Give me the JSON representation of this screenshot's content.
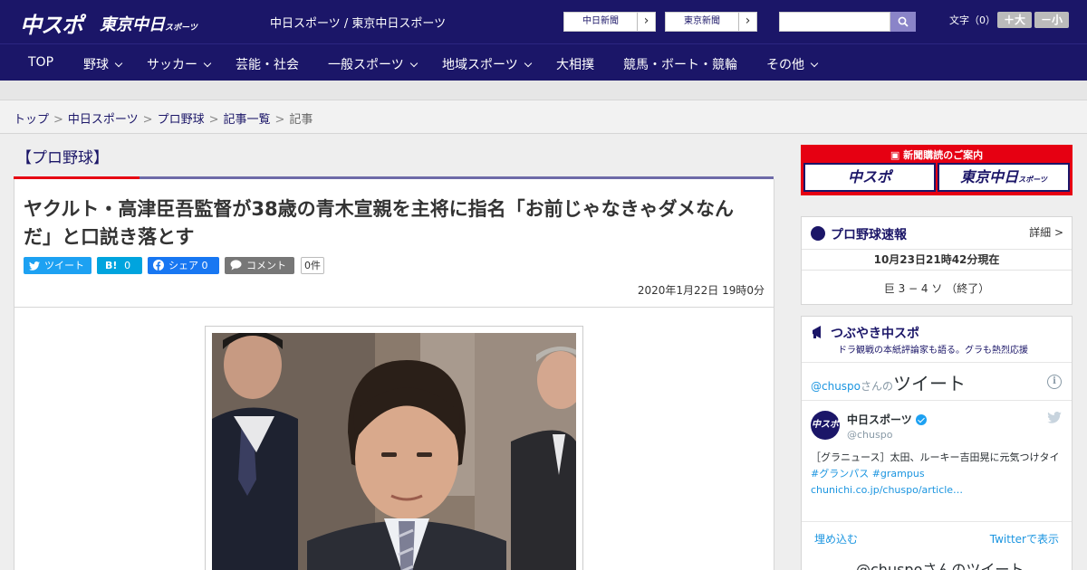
{
  "header": {
    "logo_chuspo": "中スポ",
    "logo_tokyo": "東京中日",
    "logo_tokyo_sub": "スポーツ",
    "site_title": "中日スポーツ / 東京中日スポーツ",
    "paper_links": [
      {
        "label": "中日新聞"
      },
      {
        "label": "東京新聞"
      }
    ],
    "search": {
      "placeholder": ""
    },
    "font_size_label": "文字（0）",
    "font_larger": "＋大",
    "font_smaller": "－小"
  },
  "nav": {
    "items": [
      {
        "label": "TOP",
        "has_menu": false
      },
      {
        "label": "野球",
        "has_menu": true
      },
      {
        "label": "サッカー",
        "has_menu": true
      },
      {
        "label": "芸能・社会",
        "has_menu": false
      },
      {
        "label": "一般スポーツ",
        "has_menu": true
      },
      {
        "label": "地域スポーツ",
        "has_menu": true
      },
      {
        "label": "大相撲",
        "has_menu": false
      },
      {
        "label": "競馬・ボート・競輪",
        "has_menu": false
      },
      {
        "label": "その他",
        "has_menu": true
      }
    ]
  },
  "breadcrumb": {
    "items": [
      "トップ",
      "中日スポーツ",
      "プロ野球",
      "記事一覧"
    ],
    "current": "記事",
    "separator": ">"
  },
  "article": {
    "category": "【プロ野球】",
    "headline": "ヤクルト・高津臣吾監督が38歳の青木宣親を主将に指名「お前じゃなきゃダメなんだ」と口説き落とす",
    "share": {
      "tweet": "ツイート",
      "hatena_label": "B!",
      "hatena_count": "0",
      "facebook": "シェア",
      "facebook_count": "0",
      "comment": "コメント",
      "comment_count": "0件"
    },
    "date": "2020年1月22日 19時0分"
  },
  "sidebar": {
    "subscribe": {
      "title": "新聞購読のご案内",
      "chuspo": "中スポ",
      "tokyo": "東京中日",
      "tokyo_sub": "スポーツ"
    },
    "scores": {
      "title": "プロ野球速報",
      "detail": "詳細 >",
      "time": "10月23日21時42分現在",
      "game": "巨 3 − 4 ソ （終了）"
    },
    "twitter": {
      "title": "つぶやき中スポ",
      "subtitle": "ドラ観戦の本紙評論家も語る。グラも熱烈応援",
      "head_handle": "@chuspo",
      "head_san": "さんの",
      "head_tweet": "ツイート",
      "account_name": "中日スポーツ",
      "account_handle": "@chuspo",
      "avatar_text": "中スポ",
      "tweet_text": "［グラニュース］太田、ルーキー吉田晃に元気つけタイ",
      "tweet_tags": "#グランパス #grampus",
      "tweet_link": "chunichi.co.jp/chuspo/article…",
      "embed": "埋め込む",
      "view_on_twitter": "Twitterで表示",
      "footer": "@chuspoさんのツイート"
    }
  },
  "colors": {
    "brand_navy": "#1b1668",
    "accent_red": "#e60012",
    "twitter_blue": "#1da1f2",
    "hatena_blue": "#00a4de",
    "facebook_blue": "#1877f2",
    "comment_gray": "#777777"
  }
}
